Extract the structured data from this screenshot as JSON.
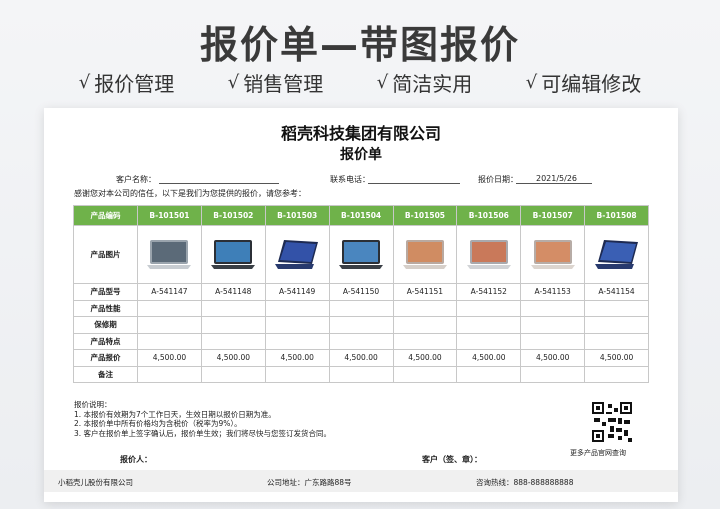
{
  "hero": {
    "title": "报价单—带图报价",
    "features": [
      "报价管理",
      "销售管理",
      "简洁实用",
      "可编辑修改"
    ]
  },
  "sheet": {
    "company": "稻壳科技集团有限公司",
    "title": "报价单",
    "customer_label": "客户名称：",
    "phone_label": "联系电话：",
    "date_label": "报价日期：",
    "date_value": "2021/5/26",
    "intro": "感谢您对本公司的信任，以下是我们为您提供的报价，请您参考：",
    "table": {
      "header_label": "产品编码",
      "codes": [
        "B-101501",
        "B-101502",
        "B-101503",
        "B-101504",
        "B-101505",
        "B-101506",
        "B-101507",
        "B-101508"
      ],
      "image_label": "产品图片",
      "image_icons": [
        "laptop-silver",
        "laptop-dark",
        "laptop-blue",
        "laptop-dark",
        "laptop-silver",
        "laptop-silver",
        "laptop-silver",
        "laptop-blue"
      ],
      "model_label": "产品型号",
      "models": [
        "A-541147",
        "A-541148",
        "A-541149",
        "A-541150",
        "A-541151",
        "A-541152",
        "A-541153",
        "A-541154"
      ],
      "performance_label": "产品性能",
      "warranty_label": "保修期",
      "features_label": "产品特点",
      "price_label": "产品报价",
      "prices": [
        "4,500.00",
        "4,500.00",
        "4,500.00",
        "4,500.00",
        "4,500.00",
        "4,500.00",
        "4,500.00",
        "4,500.00"
      ],
      "remark_label": "备注"
    },
    "notes": [
      "报价说明：",
      "1. 本报价有效期为7个工作日天，生效日期以报价日期为准。",
      "2. 本报价单中所有价格均为含税价（税率为9%）。",
      "3. 客户在报价单上签字确认后，报价单生效；我们将尽快与您签订发货合同。"
    ],
    "qr_label": "更多产品官网查询",
    "quoter_label": "报价人：",
    "customer_sign_label": "客户（签、章）：",
    "footer": {
      "company": "小稻壳儿股份有限公司",
      "address": "公司地址：广东路路88号",
      "hotline": "咨询热线：888-888888888"
    }
  }
}
